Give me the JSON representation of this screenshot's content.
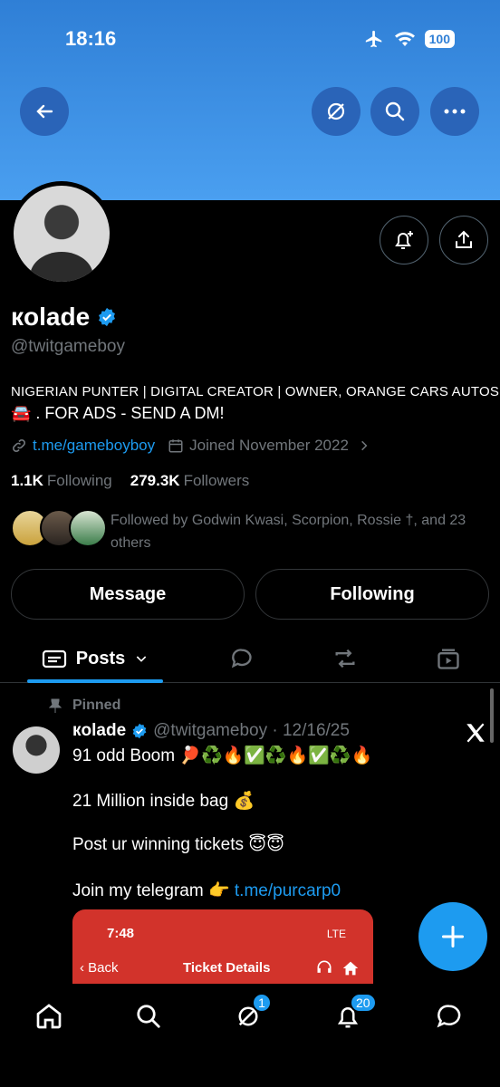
{
  "status": {
    "time": "18:16",
    "battery": "100"
  },
  "profile": {
    "display_name": "кolade",
    "handle": "@twitgameboy",
    "bio_line1": "NIGERIAN PUNTER | DIGITAL CREATOR | OWNER, ORANGE CARS AUTOS",
    "bio_line2": "🚘 . FOR ADS - SEND A DM!",
    "link": "t.me/gameboyboy",
    "joined": "Joined November 2022",
    "following_count": "1.1K",
    "following_label": "Following",
    "followers_count": "279.3K",
    "followers_label": "Followers",
    "followed_by": "Followed by Godwin Kwasi, Scorpion, Rossie †, and 23 others"
  },
  "actions": {
    "message": "Message",
    "following": "Following"
  },
  "tabs": {
    "posts": "Posts"
  },
  "post": {
    "pinned_label": "Pinned",
    "author": "кolade",
    "handle_date": "@twitgameboy · 12/16/25",
    "line1": "91 odd Boom 🏓♻️🔥✅♻️🔥✅♻️🔥",
    "line2": "21 Million inside bag 💰",
    "line3": "Post ur winning tickets 😇😇",
    "line4_prefix": "Join my telegram 👉 ",
    "line4_link": "t.me/purcarp0",
    "embed": {
      "time": "7:48",
      "status": "LTE",
      "back": "Back",
      "title": "Ticket Details"
    }
  },
  "nav": {
    "messages_badge": "1",
    "notifications_badge": "20"
  },
  "colors": {
    "accent": "#1d9bf0",
    "banner": "#4a9ff0",
    "embed_red": "#d2332b"
  }
}
